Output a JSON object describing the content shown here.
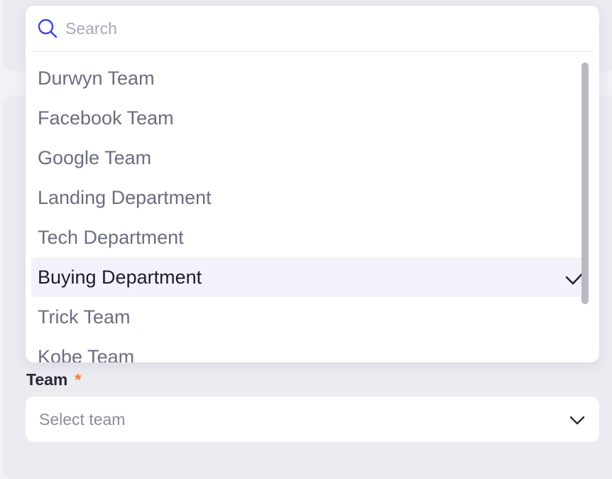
{
  "search": {
    "placeholder": "Search"
  },
  "options": [
    {
      "label": "Durwyn Team",
      "selected": false
    },
    {
      "label": "Facebook Team",
      "selected": false
    },
    {
      "label": "Google Team",
      "selected": false
    },
    {
      "label": "Landing Department",
      "selected": false
    },
    {
      "label": "Tech Department",
      "selected": false
    },
    {
      "label": "Buying Department",
      "selected": true
    },
    {
      "label": "Trick Team",
      "selected": false
    },
    {
      "label": "Kobe Team",
      "selected": false
    }
  ],
  "team_field": {
    "label": "Team",
    "required_mark": "*",
    "placeholder": "Select team"
  },
  "icons": {
    "search": "search-icon",
    "check": "check-icon",
    "chevron": "chevron-down-icon"
  },
  "colors": {
    "accent": "#3b4bd8",
    "required": "#f0783c",
    "selected_bg": "#f2f2fb"
  }
}
